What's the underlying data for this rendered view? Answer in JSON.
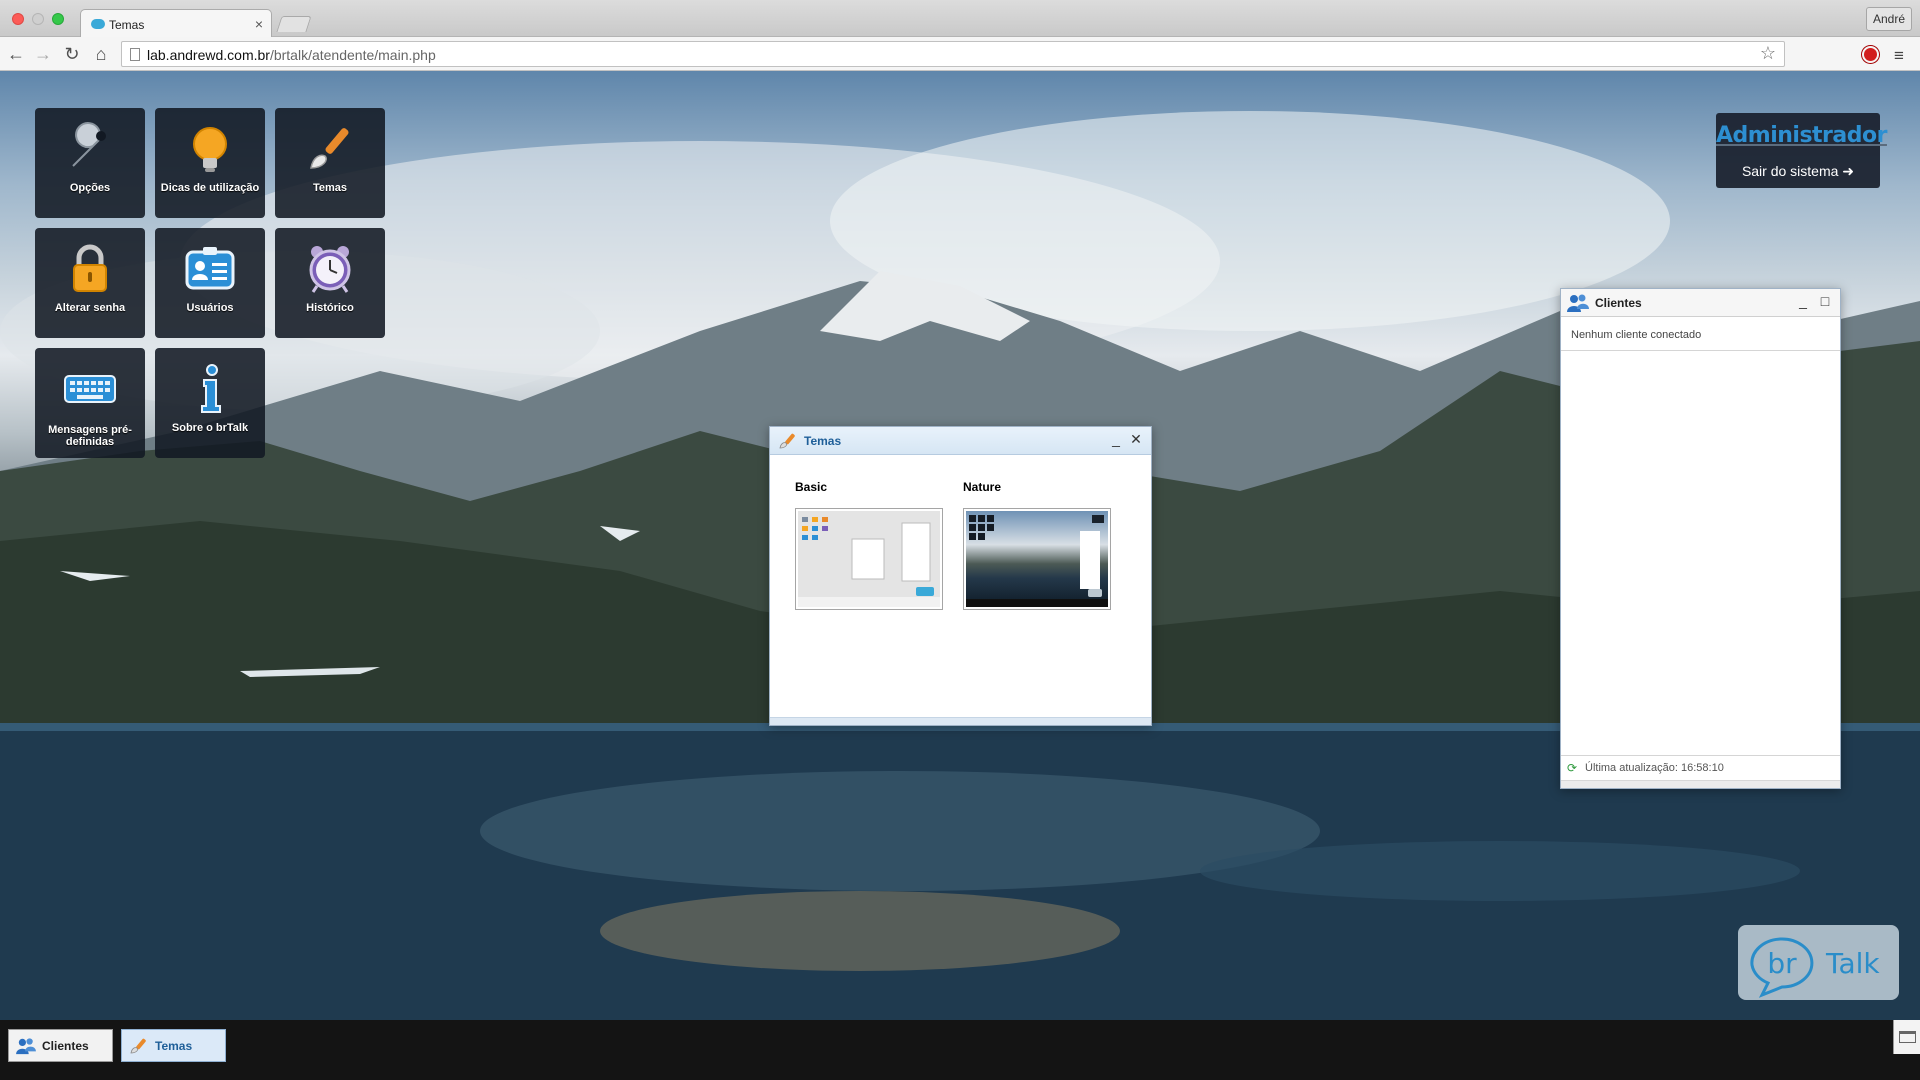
{
  "browser": {
    "tab_title": "Temas",
    "tab_close": "×",
    "profile_name": "André",
    "url_host": "lab.andrewd.com.br",
    "url_path": "/brtalk/atendente/main.php",
    "nav_back": "←",
    "nav_forward": "→",
    "nav_reload": "↻",
    "nav_home": "⌂",
    "bookmark_star": "☆",
    "menu_glyph": "≡"
  },
  "desktop_tiles": [
    {
      "label": "Opções",
      "icon": "wrench-icon"
    },
    {
      "label": "Dicas de utilização",
      "icon": "lightbulb-icon"
    },
    {
      "label": "Temas",
      "icon": "paintbrush-icon"
    },
    {
      "label": "Alterar senha",
      "icon": "padlock-icon"
    },
    {
      "label": "Usuários",
      "icon": "id-card-icon"
    },
    {
      "label": "Histórico",
      "icon": "alarm-clock-icon"
    },
    {
      "label": "Mensagens pré-definidas",
      "icon": "keyboard-icon"
    },
    {
      "label": "Sobre o brTalk",
      "icon": "info-icon"
    }
  ],
  "admin": {
    "name": "Administrador",
    "logout_label": "Sair do sistema ➜"
  },
  "temas_window": {
    "title": "Temas",
    "minimize": "_",
    "close": "✕",
    "themes": [
      {
        "name": "Basic"
      },
      {
        "name": "Nature"
      }
    ]
  },
  "clientes_window": {
    "title": "Clientes",
    "minimize": "_",
    "maximize": "□",
    "empty_message": "Nenhum cliente conectado",
    "last_update": "Última atualização: 16:58:10"
  },
  "logo": {
    "part1": "br",
    "part2": "Talk"
  },
  "taskbar": {
    "items": [
      {
        "label": "Clientes"
      },
      {
        "label": "Temas"
      }
    ]
  },
  "colors": {
    "accent": "#2d8fd1",
    "tile_bg": "#121923",
    "taskbar": "#141414"
  }
}
